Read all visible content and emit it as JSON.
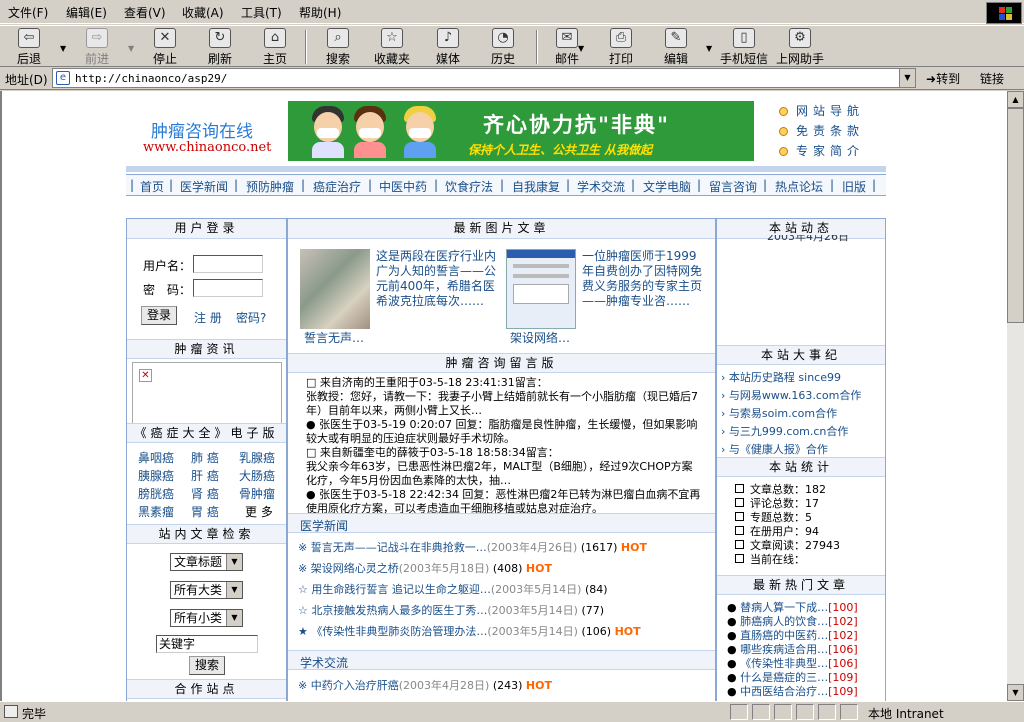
{
  "browser": {
    "menu": [
      "文件(F)",
      "编辑(E)",
      "查看(V)",
      "收藏(A)",
      "工具(T)",
      "帮助(H)"
    ],
    "toolbar": [
      {
        "label": "后退",
        "icon": "back-icon"
      },
      {
        "label": "前进",
        "icon": "forward-icon"
      },
      {
        "label": "停止",
        "icon": "stop-icon"
      },
      {
        "label": "刷新",
        "icon": "refresh-icon"
      },
      {
        "label": "主页",
        "icon": "home-icon"
      },
      {
        "label": "搜索",
        "icon": "search-icon"
      },
      {
        "label": "收藏夹",
        "icon": "favorites-icon"
      },
      {
        "label": "媒体",
        "icon": "media-icon"
      },
      {
        "label": "历史",
        "icon": "history-icon"
      },
      {
        "label": "邮件",
        "icon": "mail-icon"
      },
      {
        "label": "打印",
        "icon": "print-icon"
      },
      {
        "label": "编辑",
        "icon": "edit-icon"
      },
      {
        "label": "手机短信",
        "icon": "sms-icon"
      },
      {
        "label": "上网助手",
        "icon": "assistant-icon"
      }
    ],
    "address_label": "地址(D)",
    "url": "http://chinaonco/asp29/",
    "go_label": "转到",
    "links_label": "链接",
    "status": "完毕",
    "zone": "本地 Intranet"
  },
  "header": {
    "logo_cn": "肿瘤咨询在线",
    "logo_url": "www.chinaonco.net",
    "banner_title": "齐心协力抗\"非典\"",
    "banner_slogan": "保持个人卫生、公共卫生 从我做起",
    "right_links": [
      "网站导航",
      "免责条款",
      "专家简介"
    ]
  },
  "nav": [
    "首页",
    "医学新闻",
    "预防肿瘤",
    "癌症治疗",
    "中医中药",
    "饮食疗法",
    "自我康复",
    "学术交流",
    "文学电脑",
    "留言咨询",
    "热点论坛",
    "旧版"
  ],
  "login": {
    "title": "用户登录",
    "user_label": "用户名：",
    "pass_label": "密　码：",
    "login_btn": "登录",
    "register": "注 册",
    "forgot": "密码?"
  },
  "tumor_info": {
    "title": "肿瘤资讯"
  },
  "ebook": {
    "title": "《癌症大全》电子版",
    "items": [
      "鼻咽癌",
      "肺 癌",
      "乳腺癌",
      "胰腺癌",
      "肝 癌",
      "大肠癌",
      "膀胱癌",
      "肾 癌",
      "骨肿瘤",
      "黑素瘤",
      "胃 癌",
      "更 多"
    ]
  },
  "search": {
    "title": "站内文章检索",
    "sel1": "文章标题",
    "sel2": "所有大类",
    "sel3": "所有小类",
    "keyword": "关键字",
    "btn": "搜索"
  },
  "partner": {
    "title": "合作站点"
  },
  "photos": {
    "title": "最新图片文章",
    "items": [
      {
        "text": "这是两段在医疗行业内广为人知的誓言——公元前400年，希腊名医希波克拉底每次……",
        "caption": "誓言无声…"
      },
      {
        "text": "一位肿瘤医师于1999年自费创办了因特网免费义务服务的专家主页——肿瘤专业咨……",
        "caption": "架设网络…"
      }
    ]
  },
  "guestbook": {
    "title": "肿瘤咨询留言版",
    "entries": [
      {
        "mark": "□",
        "text": "来自济南的王重阳于03-5-18 23:41:31留言："
      },
      {
        "mark": "",
        "text": "张教授：您好，请教一下：我妻子小臂上结婚前就长有一个小脂肪瘤（现已婚后7年）目前年以来，两侧小臂上又长…"
      },
      {
        "mark": "●",
        "text": "张医生于03-5-19 0:20:07 回复：脂肪瘤是良性肿瘤，生长缓慢，但如果影响较大或有明显的压迫症状则最好手术切除。"
      },
      {
        "mark": "□",
        "text": "来自新疆奎屯的薛筱于03-5-18 18:58:34留言："
      },
      {
        "mark": "",
        "text": "我父亲今年63岁，已患恶性淋巴瘤2年，MALT型（B细胞），经过9次CHOP方案化疗，今年5月份因血色素降的太快，抽…"
      },
      {
        "mark": "●",
        "text": "张医生于03-5-18 22:42:34 回复：恶性淋巴瘤2年已转为淋巴瘤白血病不宜再使用原化疗方案，可以考虑造血干细胞移植或姑息对症治疗。"
      }
    ]
  },
  "med_news": {
    "title": "医学新闻",
    "items": [
      {
        "mark": "※",
        "title": "誓言无声——记战斗在非典抢救一…",
        "date": "2003年4月26日",
        "count": "(1617)",
        "hot": "HOT"
      },
      {
        "mark": "※",
        "title": "架设网络心灵之桥",
        "date": "2003年5月18日",
        "count": "(408)",
        "hot": "HOT"
      },
      {
        "mark": "☆",
        "title": "用生命践行誓言 追记以生命之躯迎…",
        "date": "2003年5月14日",
        "count": "(84)",
        "hot": ""
      },
      {
        "mark": "☆",
        "title": "北京接触发热病人最多的医生丁秀…",
        "date": "2003年5月14日",
        "count": "(77)",
        "hot": ""
      },
      {
        "mark": "★",
        "title": "《传染性非典型肺炎防治管理办法…",
        "date": "2003年5月14日",
        "count": "(106)",
        "hot": "HOT"
      }
    ]
  },
  "academic": {
    "title": "学术交流",
    "items": [
      {
        "mark": "※",
        "title": "中药介入治疗肝癌",
        "date": "2003年4月28日",
        "count": "(243)",
        "hot": "HOT"
      }
    ]
  },
  "site_news": {
    "title": "本站动态",
    "date": "2003年4月26日"
  },
  "events": {
    "title": "本站大事纪",
    "items": [
      "本站历史路程 since99",
      "与网易www.163.com合作",
      "与索易soim.com合作",
      "与三九999.com.cn合作",
      "与《健康人报》合作"
    ]
  },
  "stats": {
    "title": "本站统计",
    "items": [
      "文章总数：182",
      "评论总数：17",
      "专题总数：5",
      "在册用户：94",
      "文章阅读：27943",
      "当前在线："
    ]
  },
  "hot": {
    "title": "最新热门文章",
    "items": [
      {
        "title": "替病人算一下成…",
        "count": "100"
      },
      {
        "title": "肺癌病人的饮食…",
        "count": "102"
      },
      {
        "title": "直肠癌的中医药…",
        "count": "102"
      },
      {
        "title": "哪些疾病适合用…",
        "count": "106"
      },
      {
        "title": "《传染性非典型…",
        "count": "106"
      },
      {
        "title": "什么是癌症的三…",
        "count": "109"
      },
      {
        "title": "中西医结合治疗…",
        "count": "109"
      }
    ]
  }
}
